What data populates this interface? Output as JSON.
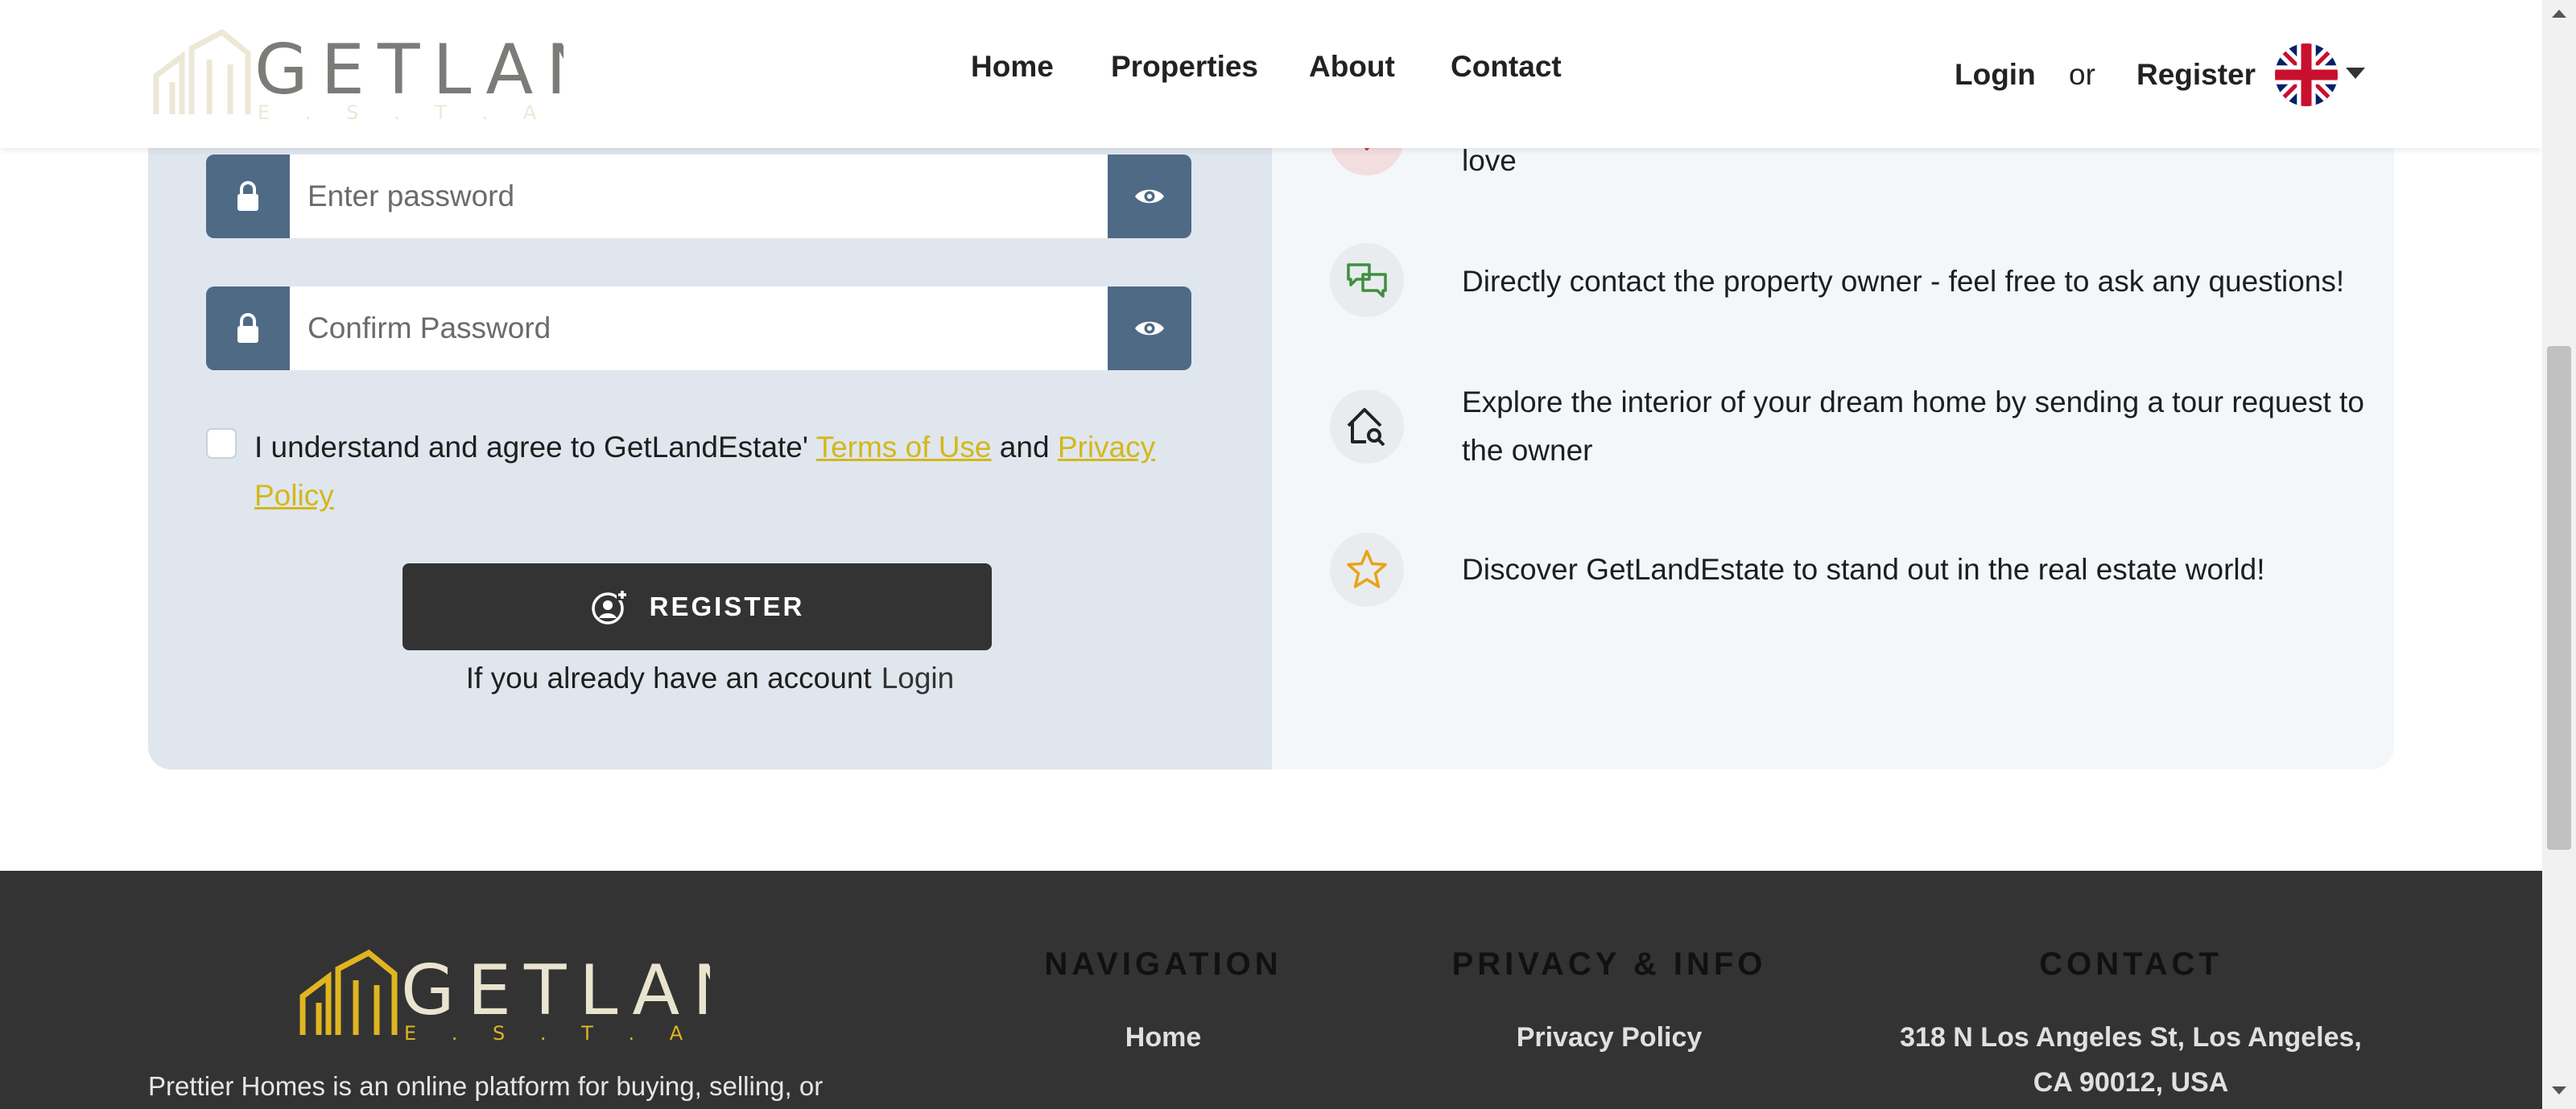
{
  "header": {
    "logo_text": "GETLAND",
    "logo_sub": "E . S . T . A . T . E .",
    "nav": [
      "Home",
      "Properties",
      "About",
      "Contact"
    ],
    "login": "Login",
    "or": "or",
    "register": "Register"
  },
  "form": {
    "password_placeholder": "Enter password",
    "confirm_placeholder": "Confirm Password",
    "agree_prefix": "I understand and agree to GetLandEstate'",
    "terms": "Terms of Use",
    "and": "and",
    "privacy": "Privacy Policy",
    "register_button": "REGISTER",
    "already": "If you already have an account",
    "login_link": "Login"
  },
  "features": [
    {
      "icon": "heart-icon",
      "text": "love"
    },
    {
      "icon": "chat-icon",
      "text": "Directly contact the property owner - feel free to ask any questions!"
    },
    {
      "icon": "home-search-icon",
      "text": "Explore the interior of your dream home by sending a tour request to the owner"
    },
    {
      "icon": "star-icon",
      "text": "Discover GetLandEstate to stand out in the real estate world!"
    }
  ],
  "footer": {
    "logo_text": "GETLAND",
    "logo_sub": "E . S . T . A . T . E .",
    "description": "Prettier Homes is an online platform for buying, selling, or",
    "navigation_title": "NAVIGATION",
    "navigation_items": [
      "Home"
    ],
    "privacy_title": "PRIVACY & INFO",
    "privacy_items": [
      "Privacy Policy"
    ],
    "contact_title": "CONTACT",
    "address": "318 N Los Angeles St, Los Angeles, CA 90012, USA"
  },
  "colors": {
    "accent": "#d4b71a",
    "dark": "#333333",
    "input_addon": "#4f6a85",
    "card_left": "#dfe6ee",
    "card_right": "#f3f7fa"
  }
}
